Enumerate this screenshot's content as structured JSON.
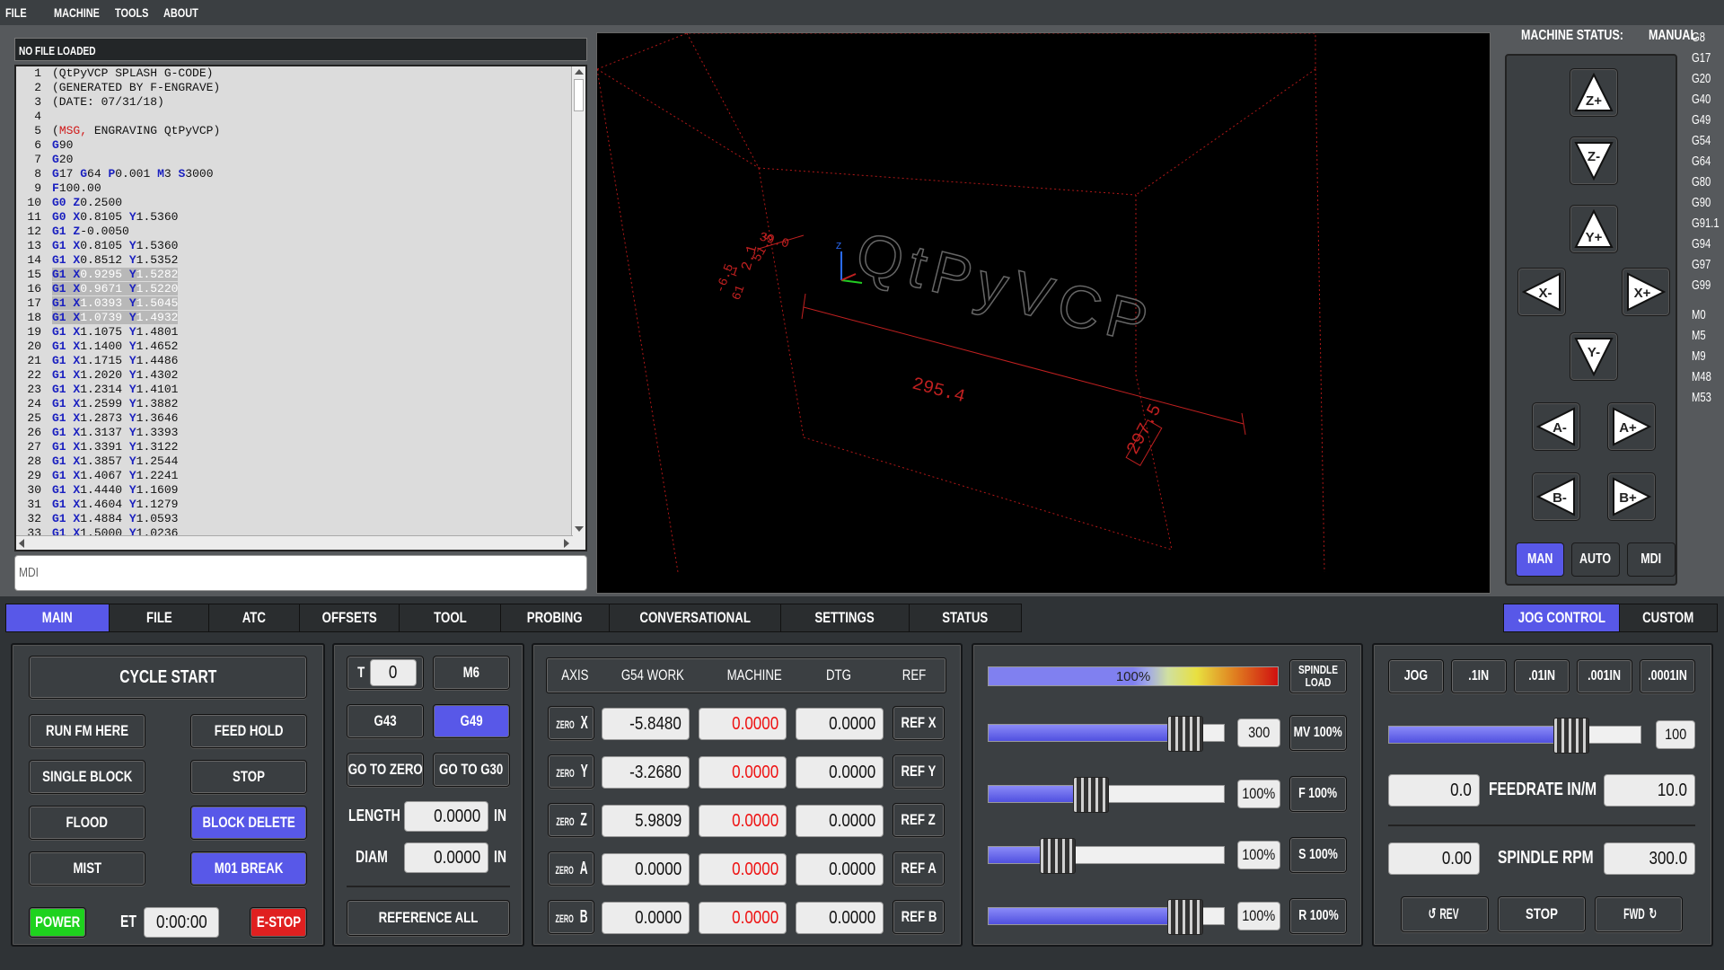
{
  "menu": [
    "FILE",
    "MACHINE",
    "TOOLS",
    "ABOUT"
  ],
  "file_status": "NO FILE LOADED",
  "gcode_lines": [
    {
      "n": "1",
      "segs": [
        [
          "t",
          "(QtPyVCP SPLASH G-CODE)"
        ]
      ]
    },
    {
      "n": "2",
      "segs": [
        [
          "t",
          "(GENERATED BY F-ENGRAVE)"
        ]
      ]
    },
    {
      "n": "3",
      "segs": [
        [
          "t",
          "(DATE: 07/31/18)"
        ]
      ]
    },
    {
      "n": "4",
      "segs": []
    },
    {
      "n": "5",
      "segs": [
        [
          "t",
          "("
        ],
        [
          "r",
          "MSG,"
        ],
        [
          "t",
          " ENGRAVING QtPyVCP)"
        ]
      ]
    },
    {
      "n": "6",
      "segs": [
        [
          "g",
          "G"
        ],
        [
          "t",
          "90"
        ]
      ]
    },
    {
      "n": "7",
      "segs": [
        [
          "g",
          "G"
        ],
        [
          "t",
          "20"
        ]
      ]
    },
    {
      "n": "8",
      "segs": [
        [
          "g",
          "G"
        ],
        [
          "t",
          "17 "
        ],
        [
          "g",
          "G"
        ],
        [
          "t",
          "64 "
        ],
        [
          "g",
          "P"
        ],
        [
          "t",
          "0.001 "
        ],
        [
          "g",
          "M"
        ],
        [
          "t",
          "3 "
        ],
        [
          "g",
          "S"
        ],
        [
          "t",
          "3000"
        ]
      ]
    },
    {
      "n": "9",
      "segs": [
        [
          "g",
          "F"
        ],
        [
          "t",
          "100.00"
        ]
      ]
    },
    {
      "n": "10",
      "segs": [
        [
          "g",
          "G0"
        ],
        [
          "t",
          " "
        ],
        [
          "g",
          "Z"
        ],
        [
          "t",
          "0.2500"
        ]
      ]
    },
    {
      "n": "11",
      "segs": [
        [
          "g",
          "G0"
        ],
        [
          "t",
          " "
        ],
        [
          "g",
          "X"
        ],
        [
          "t",
          "0.8105 "
        ],
        [
          "g",
          "Y"
        ],
        [
          "t",
          "1.5360"
        ]
      ]
    },
    {
      "n": "12",
      "segs": [
        [
          "g",
          "G1"
        ],
        [
          "t",
          " "
        ],
        [
          "g",
          "Z"
        ],
        [
          "t",
          "-0.0050"
        ]
      ]
    },
    {
      "n": "13",
      "segs": [
        [
          "g",
          "G1"
        ],
        [
          "t",
          " "
        ],
        [
          "g",
          "X"
        ],
        [
          "t",
          "0.8105 "
        ],
        [
          "g",
          "Y"
        ],
        [
          "t",
          "1.5360"
        ]
      ]
    },
    {
      "n": "14",
      "segs": [
        [
          "g",
          "G1"
        ],
        [
          "t",
          " "
        ],
        [
          "g",
          "X"
        ],
        [
          "t",
          "0.8512 "
        ],
        [
          "g",
          "Y"
        ],
        [
          "t",
          "1.5352"
        ]
      ]
    },
    {
      "n": "15",
      "sel": true,
      "segs": [
        [
          "g",
          "G1"
        ],
        [
          "t",
          " "
        ],
        [
          "g",
          "X"
        ],
        [
          "t",
          "0.9295 "
        ],
        [
          "g",
          "Y"
        ],
        [
          "t",
          "1.5282"
        ]
      ]
    },
    {
      "n": "16",
      "sel": true,
      "segs": [
        [
          "g",
          "G1"
        ],
        [
          "t",
          " "
        ],
        [
          "g",
          "X"
        ],
        [
          "t",
          "0.9671 "
        ],
        [
          "g",
          "Y"
        ],
        [
          "t",
          "1.5220"
        ]
      ]
    },
    {
      "n": "17",
      "sel": true,
      "segs": [
        [
          "g",
          "G1"
        ],
        [
          "t",
          " "
        ],
        [
          "g",
          "X"
        ],
        [
          "t",
          "1.0393 "
        ],
        [
          "g",
          "Y"
        ],
        [
          "t",
          "1.5045"
        ]
      ]
    },
    {
      "n": "18",
      "sel": true,
      "segs": [
        [
          "g",
          "G1"
        ],
        [
          "t",
          " "
        ],
        [
          "g",
          "X"
        ],
        [
          "t",
          "1.0739 "
        ],
        [
          "g",
          "Y"
        ],
        [
          "t",
          "1.4932"
        ]
      ]
    },
    {
      "n": "19",
      "segs": [
        [
          "g",
          "G1"
        ],
        [
          "t",
          " "
        ],
        [
          "g",
          "X"
        ],
        [
          "t",
          "1.1075 "
        ],
        [
          "g",
          "Y"
        ],
        [
          "t",
          "1.4801"
        ]
      ]
    },
    {
      "n": "20",
      "segs": [
        [
          "g",
          "G1"
        ],
        [
          "t",
          " "
        ],
        [
          "g",
          "X"
        ],
        [
          "t",
          "1.1400 "
        ],
        [
          "g",
          "Y"
        ],
        [
          "t",
          "1.4652"
        ]
      ]
    },
    {
      "n": "21",
      "segs": [
        [
          "g",
          "G1"
        ],
        [
          "t",
          " "
        ],
        [
          "g",
          "X"
        ],
        [
          "t",
          "1.1715 "
        ],
        [
          "g",
          "Y"
        ],
        [
          "t",
          "1.4486"
        ]
      ]
    },
    {
      "n": "22",
      "segs": [
        [
          "g",
          "G1"
        ],
        [
          "t",
          " "
        ],
        [
          "g",
          "X"
        ],
        [
          "t",
          "1.2020 "
        ],
        [
          "g",
          "Y"
        ],
        [
          "t",
          "1.4302"
        ]
      ]
    },
    {
      "n": "23",
      "segs": [
        [
          "g",
          "G1"
        ],
        [
          "t",
          " "
        ],
        [
          "g",
          "X"
        ],
        [
          "t",
          "1.2314 "
        ],
        [
          "g",
          "Y"
        ],
        [
          "t",
          "1.4101"
        ]
      ]
    },
    {
      "n": "24",
      "segs": [
        [
          "g",
          "G1"
        ],
        [
          "t",
          " "
        ],
        [
          "g",
          "X"
        ],
        [
          "t",
          "1.2599 "
        ],
        [
          "g",
          "Y"
        ],
        [
          "t",
          "1.3882"
        ]
      ]
    },
    {
      "n": "25",
      "segs": [
        [
          "g",
          "G1"
        ],
        [
          "t",
          " "
        ],
        [
          "g",
          "X"
        ],
        [
          "t",
          "1.2873 "
        ],
        [
          "g",
          "Y"
        ],
        [
          "t",
          "1.3646"
        ]
      ]
    },
    {
      "n": "26",
      "segs": [
        [
          "g",
          "G1"
        ],
        [
          "t",
          " "
        ],
        [
          "g",
          "X"
        ],
        [
          "t",
          "1.3137 "
        ],
        [
          "g",
          "Y"
        ],
        [
          "t",
          "1.3393"
        ]
      ]
    },
    {
      "n": "27",
      "segs": [
        [
          "g",
          "G1"
        ],
        [
          "t",
          " "
        ],
        [
          "g",
          "X"
        ],
        [
          "t",
          "1.3391 "
        ],
        [
          "g",
          "Y"
        ],
        [
          "t",
          "1.3122"
        ]
      ]
    },
    {
      "n": "28",
      "segs": [
        [
          "g",
          "G1"
        ],
        [
          "t",
          " "
        ],
        [
          "g",
          "X"
        ],
        [
          "t",
          "1.3857 "
        ],
        [
          "g",
          "Y"
        ],
        [
          "t",
          "1.2544"
        ]
      ]
    },
    {
      "n": "29",
      "segs": [
        [
          "g",
          "G1"
        ],
        [
          "t",
          " "
        ],
        [
          "g",
          "X"
        ],
        [
          "t",
          "1.4067 "
        ],
        [
          "g",
          "Y"
        ],
        [
          "t",
          "1.2241"
        ]
      ]
    },
    {
      "n": "30",
      "segs": [
        [
          "g",
          "G1"
        ],
        [
          "t",
          " "
        ],
        [
          "g",
          "X"
        ],
        [
          "t",
          "1.4440 "
        ],
        [
          "g",
          "Y"
        ],
        [
          "t",
          "1.1609"
        ]
      ]
    },
    {
      "n": "31",
      "segs": [
        [
          "g",
          "G1"
        ],
        [
          "t",
          " "
        ],
        [
          "g",
          "X"
        ],
        [
          "t",
          "1.4604 "
        ],
        [
          "g",
          "Y"
        ],
        [
          "t",
          "1.1279"
        ]
      ]
    },
    {
      "n": "32",
      "segs": [
        [
          "g",
          "G1"
        ],
        [
          "t",
          " "
        ],
        [
          "g",
          "X"
        ],
        [
          "t",
          "1.4884 "
        ],
        [
          "g",
          "Y"
        ],
        [
          "t",
          "1.0593"
        ]
      ]
    },
    {
      "n": "33",
      "segs": [
        [
          "g",
          "G1"
        ],
        [
          "t",
          " "
        ],
        [
          "g",
          "X"
        ],
        [
          "t",
          "1.5000 "
        ],
        [
          "g",
          "Y"
        ],
        [
          "t",
          "1.0236"
        ]
      ]
    }
  ],
  "mdi_placeholder": "MDI",
  "viewer": {
    "text": "QtPyVCP",
    "dim_x": "295.4",
    "dim_y": "297.5",
    "dim_a": "2.1",
    "dim_b": "39.0",
    "dim_c": "-1",
    "dim_d": "51.5",
    "dim_e": "-6.5",
    "dim_f": "61",
    "axis_z": "Z"
  },
  "machine_status": {
    "label": "MACHINE STATUS:",
    "mode": "MANUAL"
  },
  "active_gcodes": [
    "G8",
    "G17",
    "G20",
    "G40",
    "G49",
    "G54",
    "G64",
    "G80",
    "G90",
    "G91.1",
    "G94",
    "G97",
    "G99"
  ],
  "active_mcodes": [
    "M0",
    "M5",
    "M9",
    "M48",
    "M53"
  ],
  "jog_buttons": {
    "zp": "Z+",
    "zm": "Z-",
    "yp": "Y+",
    "xm": "X-",
    "xp": "X+",
    "ym": "Y-",
    "am": "A-",
    "ap": "A+",
    "bm": "B-",
    "bp": "B+"
  },
  "mode_buttons": [
    "MAN",
    "AUTO",
    "MDI"
  ],
  "tabs": [
    "MAIN",
    "FILE",
    "ATC",
    "OFFSETS",
    "TOOL",
    "PROBING",
    "CONVERSATIONAL",
    "SETTINGS",
    "STATUS"
  ],
  "right_tabs": [
    "JOG CONTROL",
    "CUSTOM"
  ],
  "control": {
    "cycle_start": "CYCLE START",
    "run_from_here": "RUN FM HERE",
    "feed_hold": "FEED HOLD",
    "single_block": "SINGLE BLOCK",
    "stop": "STOP",
    "flood": "FLOOD",
    "block_delete": "BLOCK DELETE",
    "mist": "MIST",
    "m01_break": "M01 BREAK",
    "power": "POWER",
    "et_label": "ET",
    "et_value": "0:00:00",
    "estop": "E-STOP"
  },
  "tool": {
    "t_label": "T",
    "t_value": "0",
    "m6": "M6",
    "g43": "G43",
    "g49": "G49",
    "goto_zero": "GO TO ZERO",
    "goto_g30": "GO TO G30",
    "length_label": "LENGTH",
    "length_value": "0.0000",
    "length_unit": "IN",
    "diam_label": "DIAM",
    "diam_value": "0.0000",
    "diam_unit": "IN",
    "reference_all": "REFERENCE ALL"
  },
  "dro": {
    "headers": [
      "AXIS",
      "G54 WORK",
      "MACHINE",
      "DTG",
      "REF"
    ],
    "zero_label": "ZERO",
    "rows": [
      {
        "axis": "X",
        "work": "-5.8480",
        "machine": "0.0000",
        "dtg": "0.0000",
        "ref": "REF X"
      },
      {
        "axis": "Y",
        "work": "-3.2680",
        "machine": "0.0000",
        "dtg": "0.0000",
        "ref": "REF Y"
      },
      {
        "axis": "Z",
        "work": "5.9809",
        "machine": "0.0000",
        "dtg": "0.0000",
        "ref": "REF Z"
      },
      {
        "axis": "A",
        "work": "0.0000",
        "machine": "0.0000",
        "dtg": "0.0000",
        "ref": "REF A"
      },
      {
        "axis": "B",
        "work": "0.0000",
        "machine": "0.0000",
        "dtg": "0.0000",
        "ref": "REF B"
      }
    ]
  },
  "overrides": {
    "spindle_load": {
      "value": "100%",
      "fraction": 0.5,
      "button": "SPINDLE LOAD"
    },
    "rows": [
      {
        "fraction": 0.83,
        "value": "300",
        "button": "MV 100%"
      },
      {
        "fraction": 0.43,
        "value": "100%",
        "button": "F 100%"
      },
      {
        "fraction": 0.29,
        "value": "100%",
        "button": "S 100%"
      },
      {
        "fraction": 0.83,
        "value": "100%",
        "button": "R 100%"
      }
    ]
  },
  "jog": {
    "buttons": [
      "JOG",
      ".1IN",
      ".01IN",
      ".001IN",
      ".0001IN"
    ],
    "speed_fraction": 0.72,
    "speed_value": "100",
    "feedrate_actual": "0.0",
    "feedrate_label": "FEEDRATE IN/M",
    "feedrate_set": "10.0",
    "spindle_actual": "0.00",
    "spindle_label": "SPINDLE RPM",
    "spindle_set": "300.0",
    "rev": "REV",
    "stop": "STOP",
    "fwd": "FWD"
  },
  "colors": {
    "accent": "#5858e8",
    "estop": "#e02020",
    "power": "#1ed21e",
    "machine_value": "#ee1111",
    "gcode_word": "#1a20c0",
    "viewer_lines": "#b01818"
  }
}
